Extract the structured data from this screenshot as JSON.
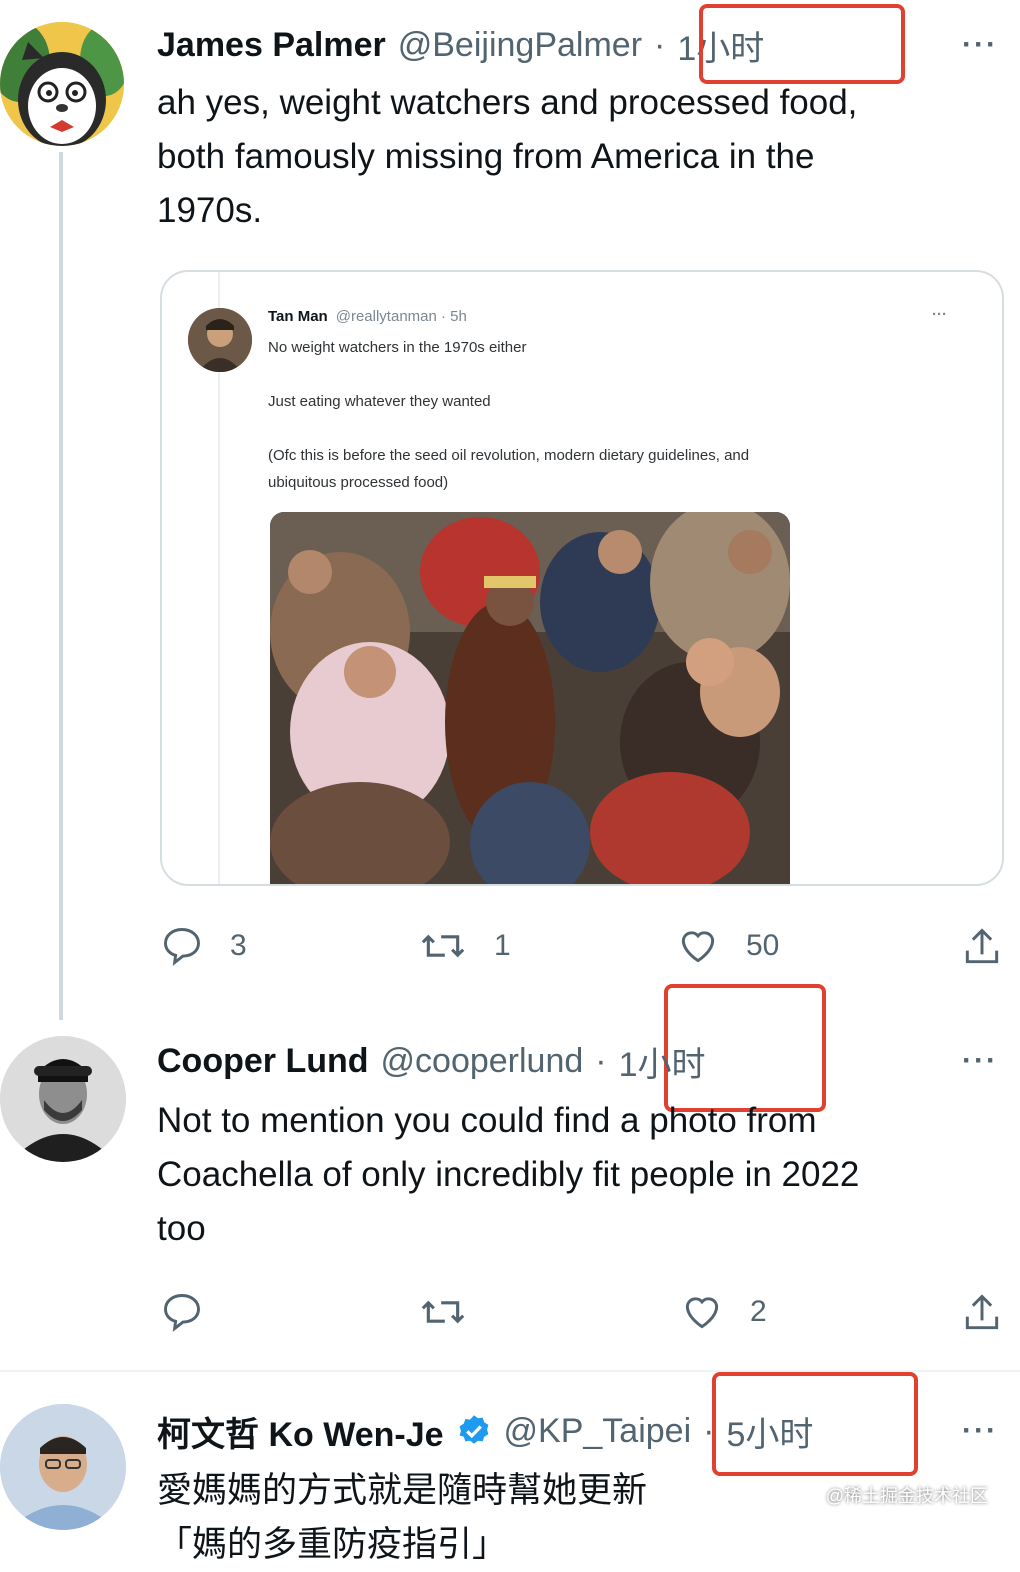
{
  "tweets": [
    {
      "name": "James Palmer",
      "handle": "@BeijingPalmer",
      "sep": "·",
      "time": "1小时",
      "text": [
        "ah yes, weight watchers and processed food,",
        "both famously missing from America in the",
        "1970s."
      ],
      "more": "···",
      "quote": {
        "name": "Tan Man",
        "handle": "@reallytanman · 5h",
        "more": "···",
        "lines": [
          "No weight watchers in the 1970s either",
          "Just eating whatever they wanted",
          "(Ofc this is before the seed oil revolution, modern dietary guidelines, and",
          "ubiquitous processed food)"
        ]
      },
      "actions": {
        "reply_count": "3",
        "retweet_count": "1",
        "like_count": "50"
      }
    },
    {
      "name": "Cooper Lund",
      "handle": "@cooperlund",
      "sep": "·",
      "time": "1小时",
      "text": [
        "Not to mention you could find a photo from",
        "Coachella of only incredibly fit people in 2022",
        "too"
      ],
      "more": "···",
      "actions": {
        "like_count": "2"
      }
    },
    {
      "name": "柯文哲 Ko Wen-Je",
      "handle": "@KP_Taipei",
      "sep": "·",
      "time": "5小时",
      "text": [
        "愛媽媽的方式就是隨時幫她更新",
        "「媽的多重防疫指引」"
      ],
      "more": "···",
      "verified": true
    }
  ],
  "watermark": "@稀土掘金技术社区",
  "colors": {
    "highlight": "#e0402f",
    "verified": "#1d9bf0",
    "muted": "#536471",
    "thread": "#cfd9de"
  }
}
